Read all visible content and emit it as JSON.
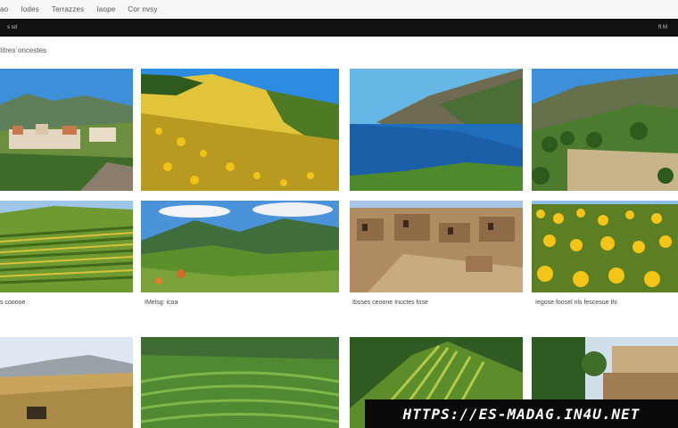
{
  "topnav": {
    "links": [
      "ao",
      "Iodes",
      "Terrazzes",
      "Iaope",
      "Cor nvsy"
    ]
  },
  "toolbar": {
    "left_text": "s  sd",
    "right_text": "ft M"
  },
  "gallery": {
    "title": "Iitres´oncestes",
    "captions": [
      "s cooooe",
      "IMelsg: icoa",
      "Ibsses  ceoone  Inuctes fose",
      "Iegose  foosel  nls fescesue thi"
    ],
    "photos": [
      "hillside-village",
      "yellow-flower-hill",
      "coastal-cliffs",
      "mountain-valley",
      "vineyard-rows",
      "green-mountains",
      "old-stone-town",
      "sunflower-field",
      "wheat-fields",
      "terraced-valley",
      "striped-hill",
      "village-trees"
    ]
  },
  "watermark": {
    "text": "HTTPS://ES-MADAG.IN4U.NET"
  },
  "colors": {
    "toolbar": "#111111",
    "watermark_bg": "#0a0a0a",
    "nav_bg": "#f6f6f6"
  }
}
